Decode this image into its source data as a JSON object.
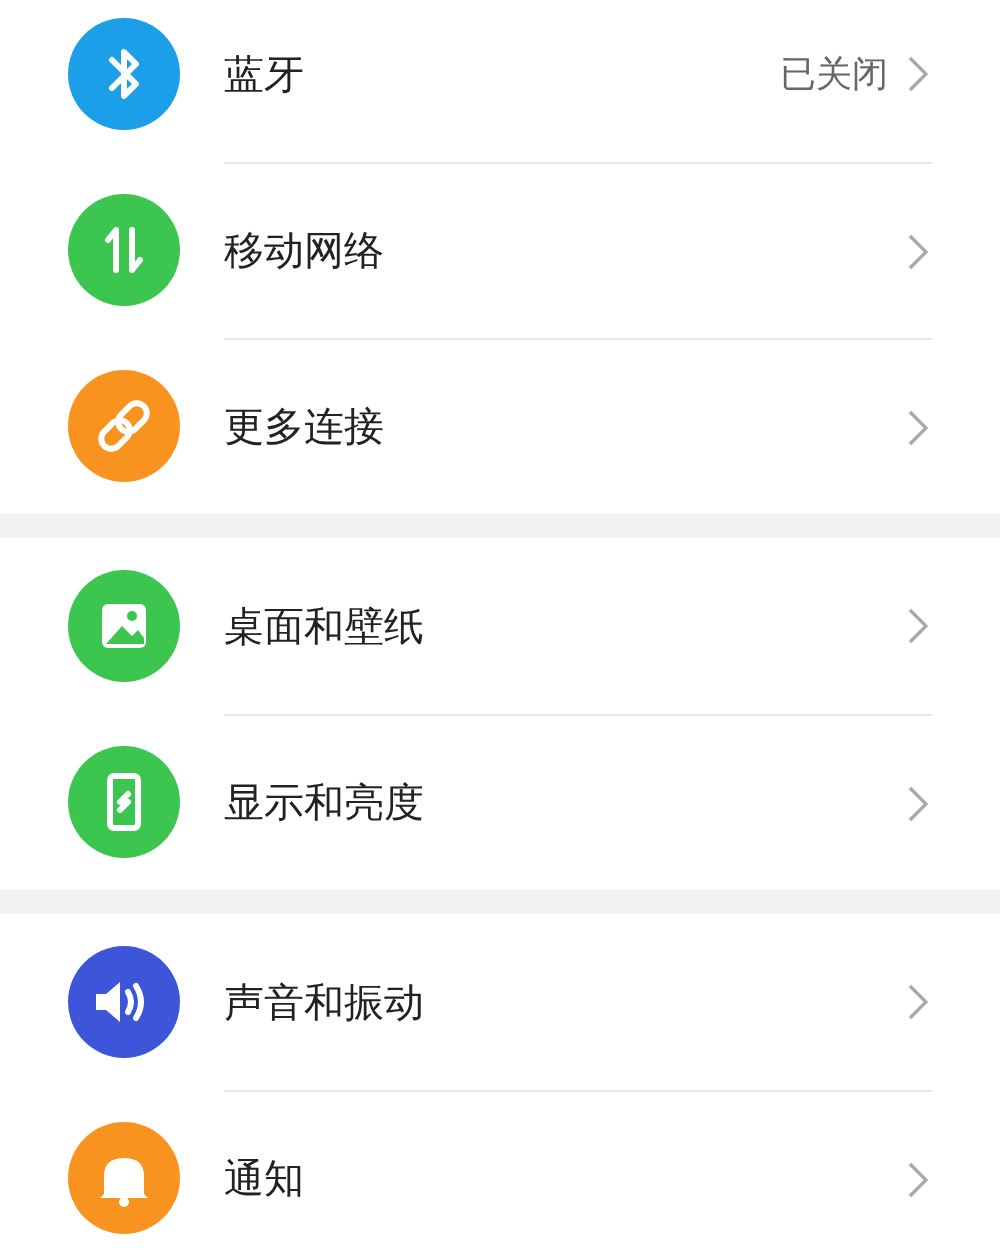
{
  "sections": [
    {
      "items": [
        {
          "kind": "bluetooth",
          "color": "#1a9fe8",
          "label": "蓝牙",
          "value": "已关闭"
        },
        {
          "kind": "data",
          "color": "#3cc64f",
          "label": "移动网络"
        },
        {
          "kind": "link",
          "color": "#f7931e",
          "label": "更多连接"
        }
      ]
    },
    {
      "items": [
        {
          "kind": "wallpaper",
          "color": "#3cc64f",
          "label": "桌面和壁纸"
        },
        {
          "kind": "display",
          "color": "#3cc64f",
          "label": "显示和亮度"
        }
      ]
    },
    {
      "items": [
        {
          "kind": "sound",
          "color": "#3d55d8",
          "label": "声音和振动"
        },
        {
          "kind": "bell",
          "color": "#f7931e",
          "label": "通知"
        }
      ]
    }
  ]
}
